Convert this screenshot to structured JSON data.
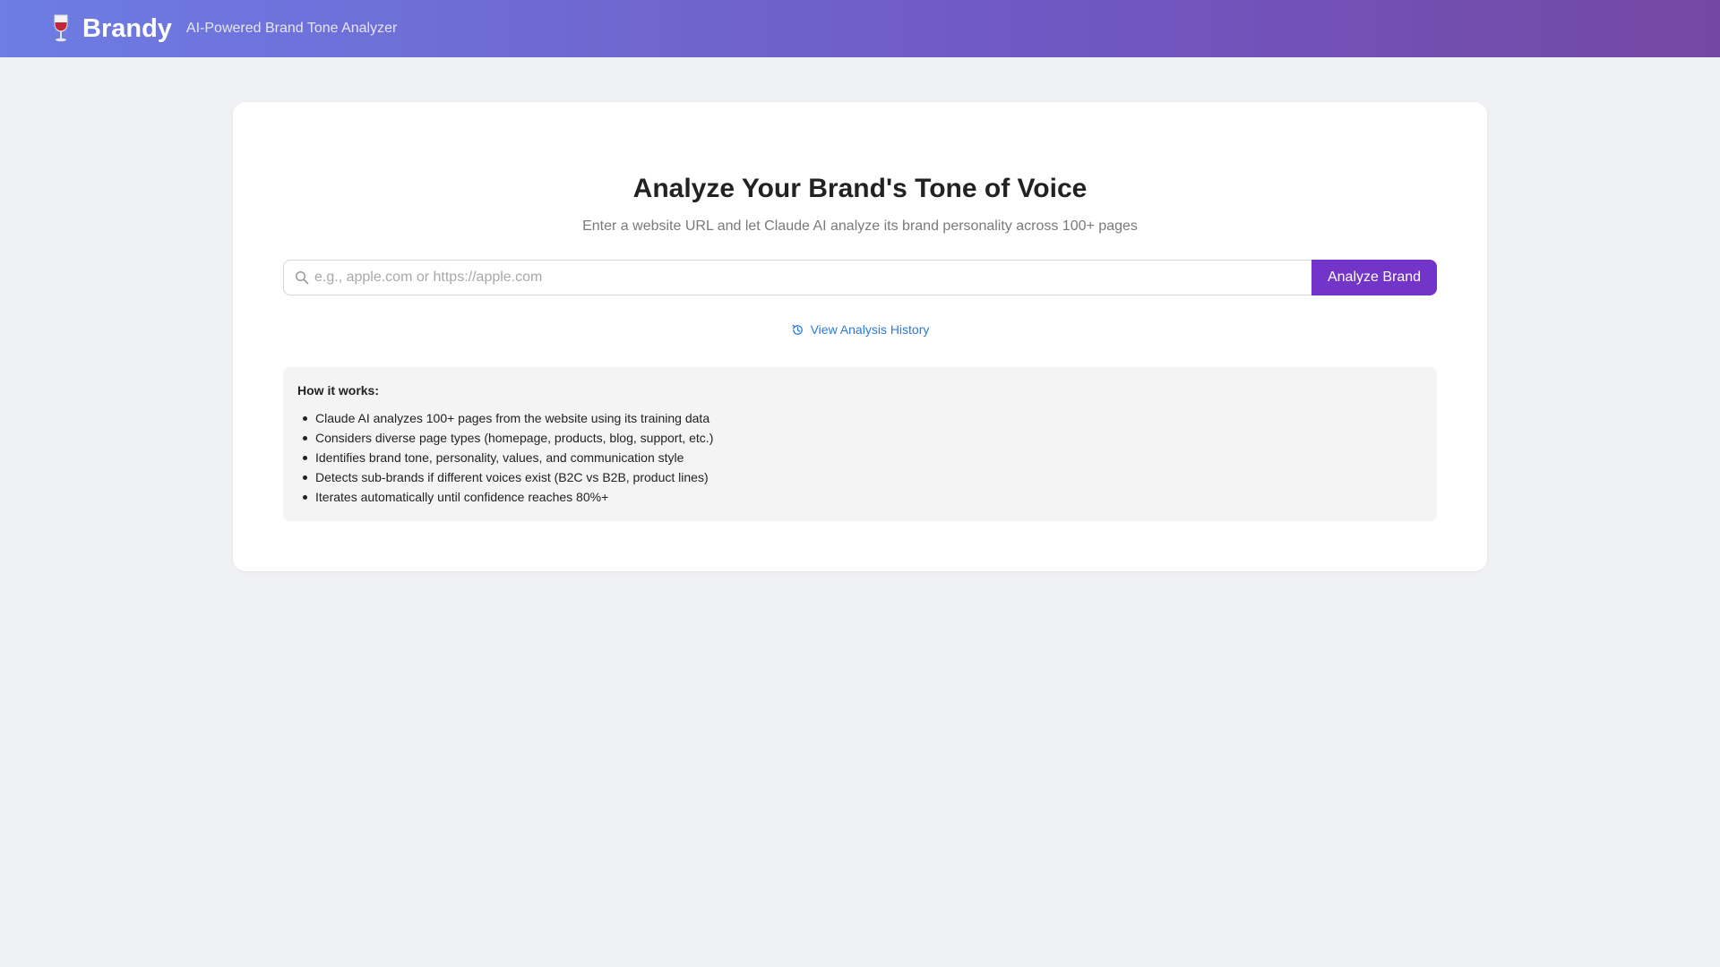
{
  "header": {
    "logo_icon": "wine-glass-icon",
    "brand_name": "Brandy",
    "tagline": "AI-Powered Brand Tone Analyzer",
    "gradient_start": "#6d7de3",
    "gradient_end": "#7447a3"
  },
  "main": {
    "title": "Analyze Your Brand's Tone of Voice",
    "subtitle": "Enter a website URL and let Claude AI analyze its brand personality across 100+ pages",
    "search": {
      "icon": "search-icon",
      "placeholder": "e.g., apple.com or https://apple.com",
      "value": ""
    },
    "analyze_button": {
      "label": "Analyze Brand",
      "color": "#7334c9"
    },
    "history_link": {
      "icon": "history-icon",
      "label": "View Analysis History",
      "color": "#2d7bd9"
    },
    "how_it_works": {
      "title": "How it works:",
      "items": [
        "Claude AI analyzes 100+ pages from the website using its training data",
        "Considers diverse page types (homepage, products, blog, support, etc.)",
        "Identifies brand tone, personality, values, and communication style",
        "Detects sub-brands if different voices exist (B2C vs B2B, product lines)",
        "Iterates automatically until confidence reaches 80%+"
      ]
    }
  }
}
